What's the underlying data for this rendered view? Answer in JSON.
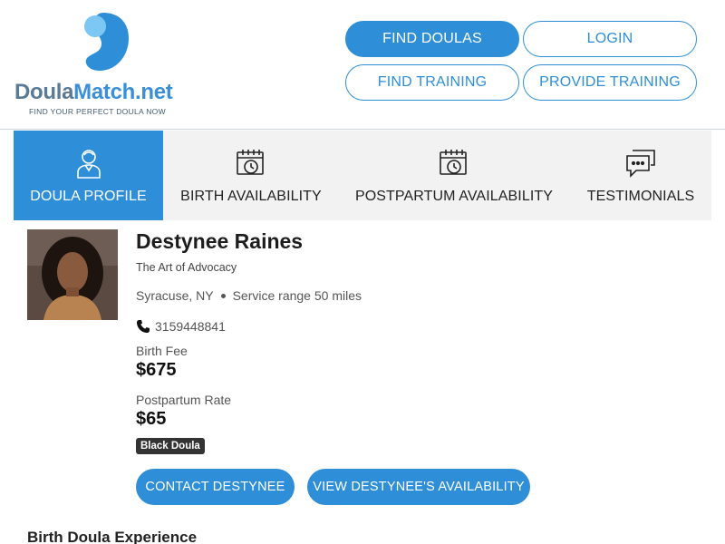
{
  "brand": {
    "name_part1": "Doula",
    "name_part2": "Match.net",
    "tagline": "FIND YOUR PERFECT DOULA NOW",
    "colors": {
      "primary": "#2e8fd8",
      "light": "#7cc7f4",
      "gray": "#5a7b96"
    }
  },
  "nav": {
    "find_doulas": "FIND DOULAS",
    "login": "LOGIN",
    "find_training": "FIND TRAINING",
    "provide_training": "PROVIDE TRAINING"
  },
  "tabs": [
    {
      "label": "DOULA PROFILE",
      "icon": "doula-person-icon",
      "active": true
    },
    {
      "label": "BIRTH AVAILABILITY",
      "icon": "calendar-clock-icon",
      "active": false
    },
    {
      "label": "POSTPARTUM AVAILABILITY",
      "icon": "calendar-clock-icon",
      "active": false
    },
    {
      "label": "TESTIMONIALS",
      "icon": "chat-bubbles-icon",
      "active": false
    }
  ],
  "profile": {
    "name": "Destynee Raines",
    "agency": "The Art of Advocacy",
    "city": "Syracuse, NY",
    "service_range": "Service range 50 miles",
    "phone": "3159448841",
    "birth_fee_label": "Birth Fee",
    "birth_fee": "$675",
    "postpartum_label": "Postpartum Rate",
    "postpartum_rate": "$65",
    "badge": "Black Doula",
    "contact_button": "CONTACT DESTYNEE",
    "availability_button": "VIEW DESTYNEE'S AVAILABILITY"
  },
  "sections": {
    "birth_experience_title": "Birth Doula Experience"
  }
}
